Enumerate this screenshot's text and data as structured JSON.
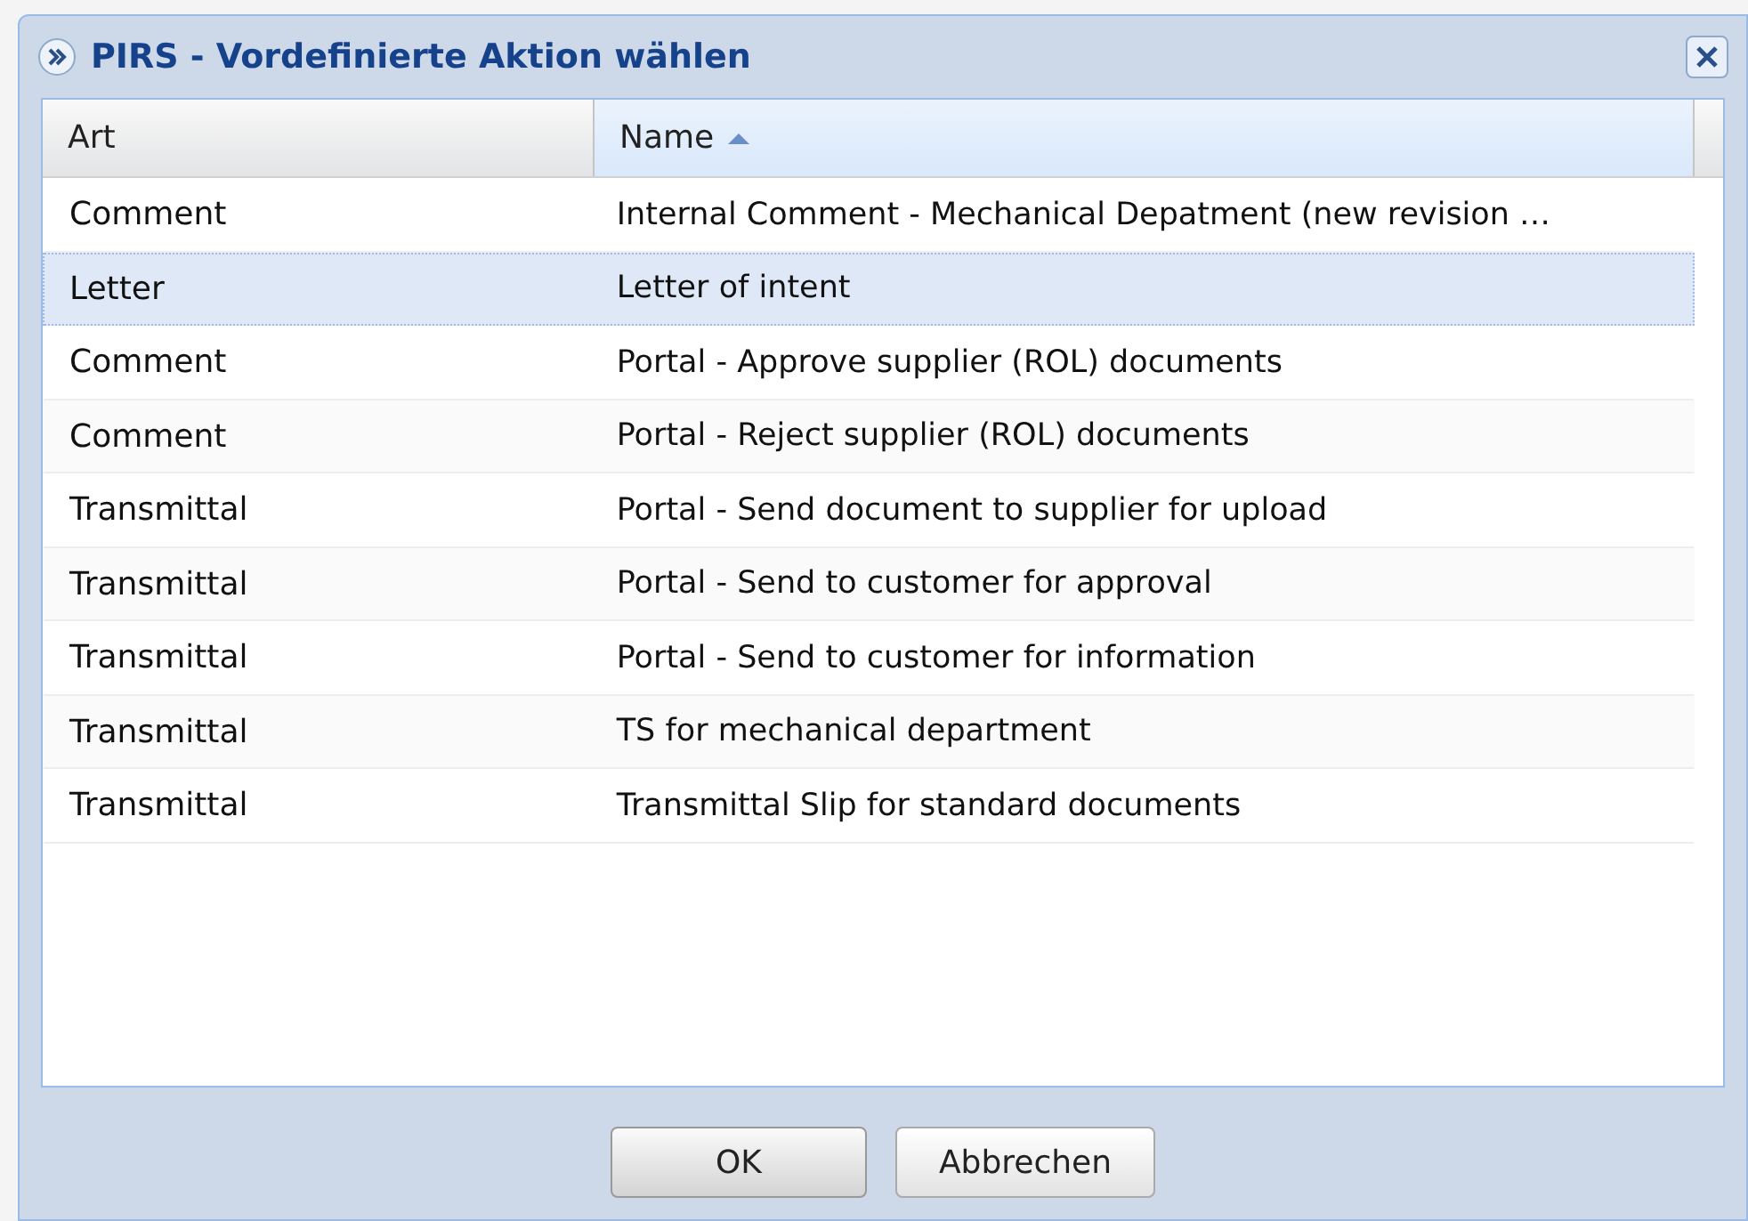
{
  "window": {
    "title": "PIRS - Vordefinierte Aktion wählen"
  },
  "table": {
    "columns": [
      {
        "label": "Art",
        "sorted": false
      },
      {
        "label": "Name",
        "sorted": true
      }
    ],
    "rows": [
      {
        "art": "Comment",
        "name": "Internal Comment - Mechanical Depatment (new revision …",
        "selected": false
      },
      {
        "art": "Letter",
        "name": "Letter of intent",
        "selected": true
      },
      {
        "art": "Comment",
        "name": "Portal - Approve supplier (ROL) documents",
        "selected": false
      },
      {
        "art": "Comment",
        "name": "Portal - Reject supplier (ROL) documents",
        "selected": false
      },
      {
        "art": "Transmittal",
        "name": "Portal - Send document to supplier for upload",
        "selected": false
      },
      {
        "art": "Transmittal",
        "name": "Portal - Send to customer for approval",
        "selected": false
      },
      {
        "art": "Transmittal",
        "name": "Portal - Send to customer for information",
        "selected": false
      },
      {
        "art": "Transmittal",
        "name": "TS for mechanical department",
        "selected": false
      },
      {
        "art": "Transmittal",
        "name": "Transmittal Slip for standard documents",
        "selected": false
      }
    ]
  },
  "buttons": [
    {
      "label": "OK",
      "hovered": true
    },
    {
      "label": "Abbrechen",
      "hovered": false
    }
  ]
}
